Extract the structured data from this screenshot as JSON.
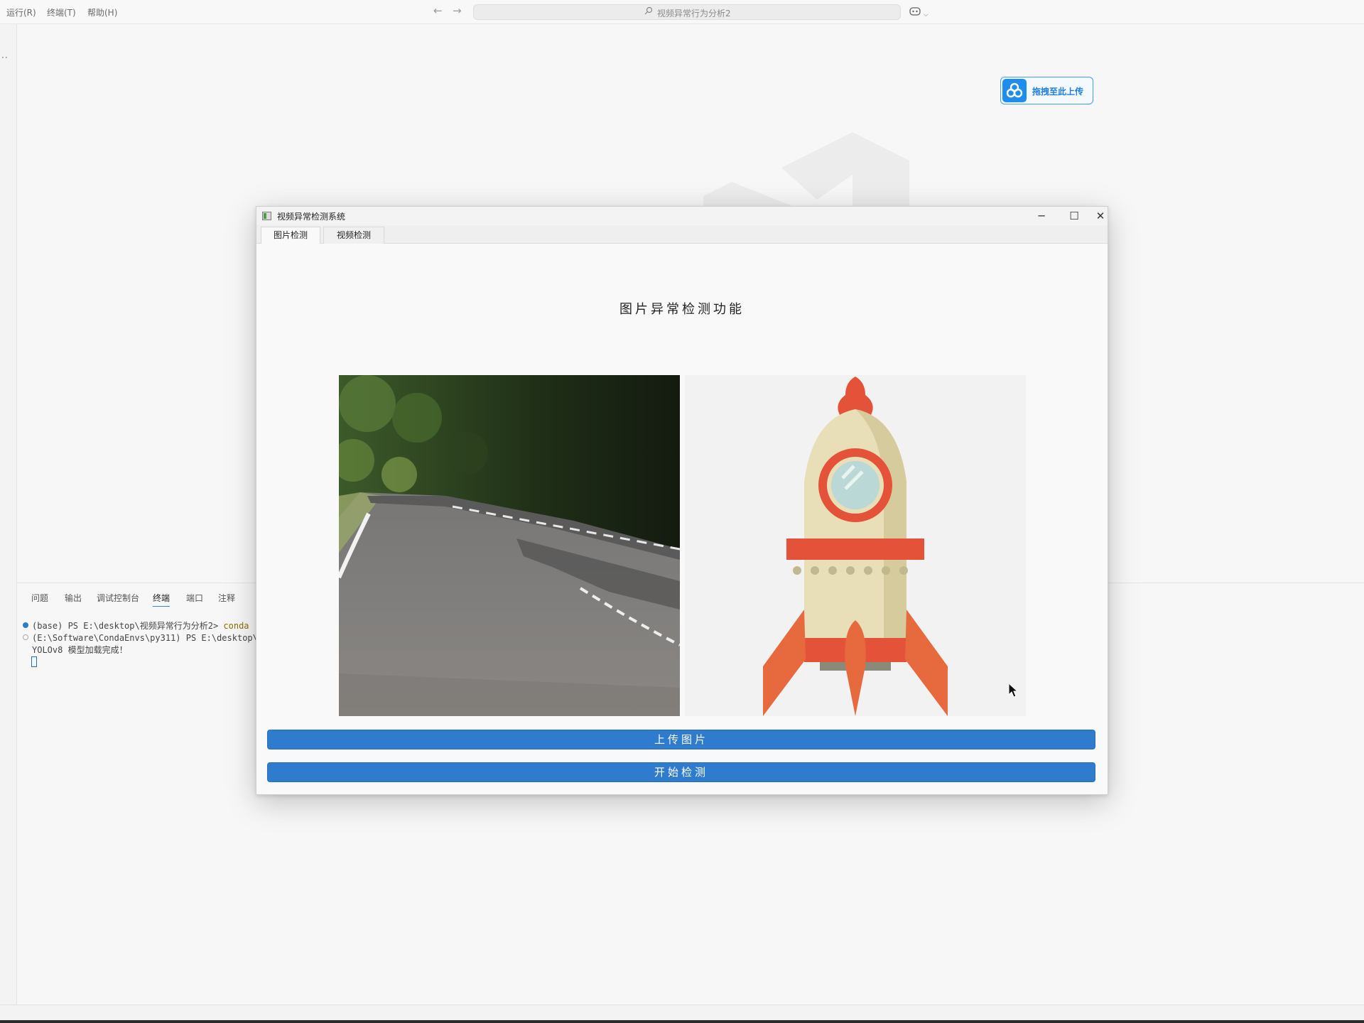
{
  "editor": {
    "menu": {
      "run": "运行(R)",
      "terminal": "终端(T)",
      "help": "帮助(H)"
    },
    "command_center": "视频异常行为分析2",
    "upload_badge": "拖拽至此上传",
    "panel_tabs": [
      "问题",
      "输出",
      "调试控制台",
      "终端",
      "端口",
      "注释"
    ],
    "terminal": {
      "line1_prefix": "(base) PS E:\\desktop\\视频异常行为分析2> ",
      "line1_cmd": "conda",
      "line2": "(E:\\Software\\CondaEnvs\\py311) PS E:\\desktop\\视",
      "line3": "YOLOv8 模型加载完成！"
    }
  },
  "app": {
    "window_title": "视频异常检测系统",
    "tabs": [
      "图片检测",
      "视频检测"
    ],
    "heading": "图片异常检测功能",
    "upload_button": "上传图片",
    "detect_button": "开始检测"
  },
  "colors": {
    "accent_button": "#2f7bcd",
    "upload_badge": "#1f8dee",
    "rocket_red": "#e5523a",
    "rocket_body": "#e8dfb8"
  }
}
